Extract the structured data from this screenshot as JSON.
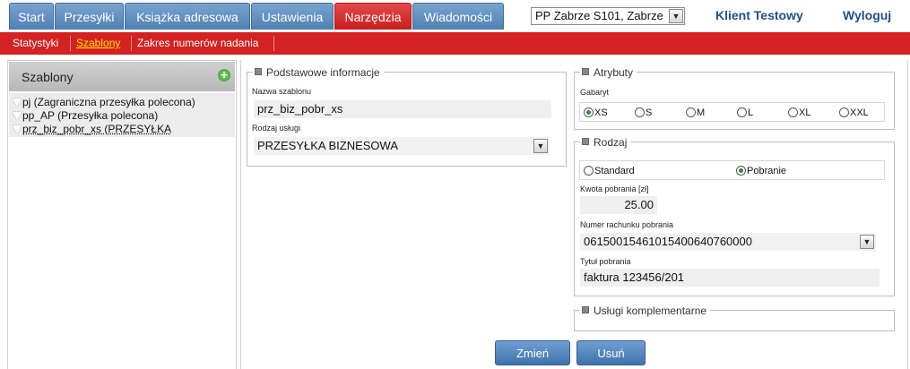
{
  "nav": {
    "tabs": [
      {
        "label": "Start"
      },
      {
        "label": "Przesyłki"
      },
      {
        "label": "Książka adresowa"
      },
      {
        "label": "Ustawienia"
      },
      {
        "label": "Narzędzia"
      },
      {
        "label": "Wiadomości"
      }
    ],
    "active_tab": "Narzędzia",
    "location_select": "PP Zabrze S101, Zabrze",
    "client": "Klient Testowy",
    "logout": "Wyloguj"
  },
  "subnav": {
    "items": [
      {
        "label": "Statystyki"
      },
      {
        "label": "Szablony"
      },
      {
        "label": "Zakres numerów nadania"
      }
    ],
    "active": "Szablony"
  },
  "templates": {
    "title": "Szablony",
    "items": [
      {
        "label": "pj (Zagraniczna przesyłka polecona)"
      },
      {
        "label": "pp_AP (Przesyłka polecona)"
      },
      {
        "label": "prz_biz_pobr_xs (PRZESYŁKA"
      }
    ]
  },
  "basic": {
    "legend": "Podstawowe informacje",
    "name_label": "Nazwa szablonu",
    "name_value": "prz_biz_pobr_xs",
    "service_label": "Rodzaj usługi",
    "service_value": "PRZESYŁKA BIZNESOWA"
  },
  "attributes": {
    "legend": "Atrybuty",
    "gabaryt_label": "Gabaryt",
    "sizes": [
      {
        "label": "XS",
        "selected": true
      },
      {
        "label": "S",
        "selected": false
      },
      {
        "label": "M",
        "selected": false
      },
      {
        "label": "L",
        "selected": false
      },
      {
        "label": "XL",
        "selected": false
      },
      {
        "label": "XXL",
        "selected": false
      }
    ]
  },
  "kind": {
    "legend": "Rodzaj",
    "options": [
      {
        "label": "Standard",
        "selected": false
      },
      {
        "label": "Pobranie",
        "selected": true
      }
    ],
    "amount_label": "Kwota pobrania [zł]",
    "amount_value": "25.00",
    "account_label": "Numer rachunku pobrania",
    "account_value": "06150015461015400640760000",
    "title_label": "Tytuł pobrania",
    "title_value": "faktura 123456/201"
  },
  "extra": {
    "legend": "Usługi komplementarne"
  },
  "buttons": {
    "change": "Zmień",
    "delete": "Usuń"
  },
  "colors": {
    "tab_blue": "#5a88bb",
    "tab_active_red": "#d42222",
    "subbar_red": "#d42222",
    "link_blue": "#1f4e8f",
    "radio_green": "#2e8b2e"
  }
}
